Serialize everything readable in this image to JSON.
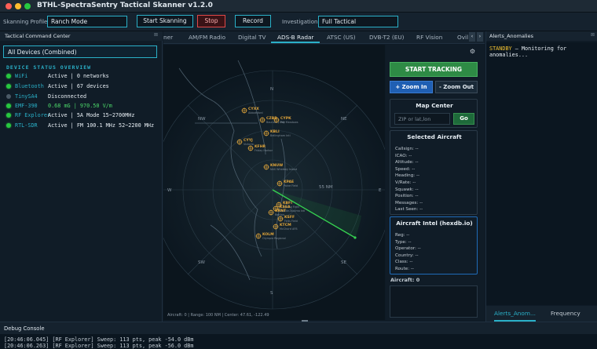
{
  "window": {
    "title": "BTHL-SpectraSentry Tactical Skanner v1.2.0"
  },
  "toolbar": {
    "profile_label": "Skanning Profile:",
    "profile_value": "Ranch Mode",
    "start_label": "Start Skanning",
    "stop_label": "Stop",
    "record_label": "Record",
    "investigation_label": "Investigation:",
    "investigation_value": "Full Tactical"
  },
  "left": {
    "title": "Tactical Command Center",
    "close": "⊠",
    "device_select": "All Devices (Combined)",
    "overview_title": "DEVICE STATUS OVERVIEW",
    "devices": [
      {
        "name": "WiFi",
        "status": "Active | 0 networks",
        "active": true
      },
      {
        "name": "Bluetooth",
        "status": "Active | 67 devices",
        "active": true
      },
      {
        "name": "TinySA4",
        "status": "Disconnected",
        "active": false
      },
      {
        "name": "EMF-390",
        "status": "0.68 mG | 970.50 V/m",
        "active": true
      },
      {
        "name": "RF Explorer",
        "status": "Active | 5A Mode  15~2700MHz",
        "active": true
      },
      {
        "name": "RTL-SDR",
        "status": "Active | FM 100.1 MHz  52~2200 MHz",
        "active": true
      }
    ]
  },
  "tabs": {
    "items": [
      "ner",
      "AM/FM Radio",
      "Digital TV",
      "ADS-B Radar",
      "ATSC (US)",
      "DVB-T2 (EU)",
      "RF Vision",
      "Ovil"
    ],
    "active_index": 3,
    "prev": "‹",
    "next": "›"
  },
  "radar": {
    "compass": {
      "n": "N",
      "ne": "NE",
      "e": "E",
      "se": "SE",
      "s": "S",
      "sw": "SW",
      "w": "W",
      "nw": "NW"
    },
    "footer": "Aircraft: 0 | Range: 100 NM | Center: 47.61, -122.49",
    "range_label": "55 NM",
    "airports": [
      {
        "code": "CYXX",
        "name": "Abbotsford"
      },
      {
        "code": "CZBB",
        "name": "Boundary Bay"
      },
      {
        "code": "CYPK",
        "name": "Pitt Meadows"
      },
      {
        "code": "KBLI",
        "name": "Bellingham Intl"
      },
      {
        "code": "CYYJ",
        "name": "Victoria"
      },
      {
        "code": "KFHR",
        "name": "Friday Harbor"
      },
      {
        "code": "KNUW",
        "name": "NAS Whidbey Island"
      },
      {
        "code": "KPAE",
        "name": "Paine Field"
      },
      {
        "code": "KBFI",
        "name": "Boeing Field"
      },
      {
        "code": "KSEA",
        "name": "Seattle-Tacoma Intl"
      },
      {
        "code": "KRNT",
        "name": "Renton"
      },
      {
        "code": "KSFF",
        "name": "Felts Field"
      },
      {
        "code": "KTCM",
        "name": "McChord AFB"
      },
      {
        "code": "KOLM",
        "name": "Olympia Regional"
      }
    ]
  },
  "controls": {
    "gear": "⚙",
    "start_tracking": "START TRACKING",
    "zoom_in": "+ Zoom In",
    "zoom_out": "- Zoom Out",
    "map_center_title": "Map Center",
    "map_center_placeholder": "ZIP or lat,lon",
    "go": "Go",
    "selected_title": "Selected Aircraft",
    "selected_fields": [
      "Callsign: --",
      "ICAO: --",
      "Altitude: --",
      "Speed: --",
      "Heading: --",
      "V/Rate: --",
      "Squawk: --",
      "Position: --",
      "Messages: --",
      "Last Seen: --"
    ],
    "intel_title": "Aircraft Intel (hexdb.io)",
    "intel_fields": [
      "Reg: --",
      "Type: --",
      "Operator: --",
      "Country: --",
      "Class: --",
      "Route: --"
    ],
    "aircraft_count": "Aircraft: 0"
  },
  "alerts": {
    "title": "Alerts_Anomalies",
    "close": "⊠",
    "standby": "STANDBY",
    "message": " — Monitoring for anomalies...",
    "tabs": [
      "Alerts_Anom...",
      "Frequency Gener..."
    ]
  },
  "console": {
    "title": "Debug Console",
    "lines": [
      "[20:46:06.045] [RF Explorer] Sweep: 113 pts, peak -54.0 dBm",
      "[20:46:06.263] [RF Explorer] Sweep: 113 pts, peak -56.0 dBm"
    ]
  }
}
